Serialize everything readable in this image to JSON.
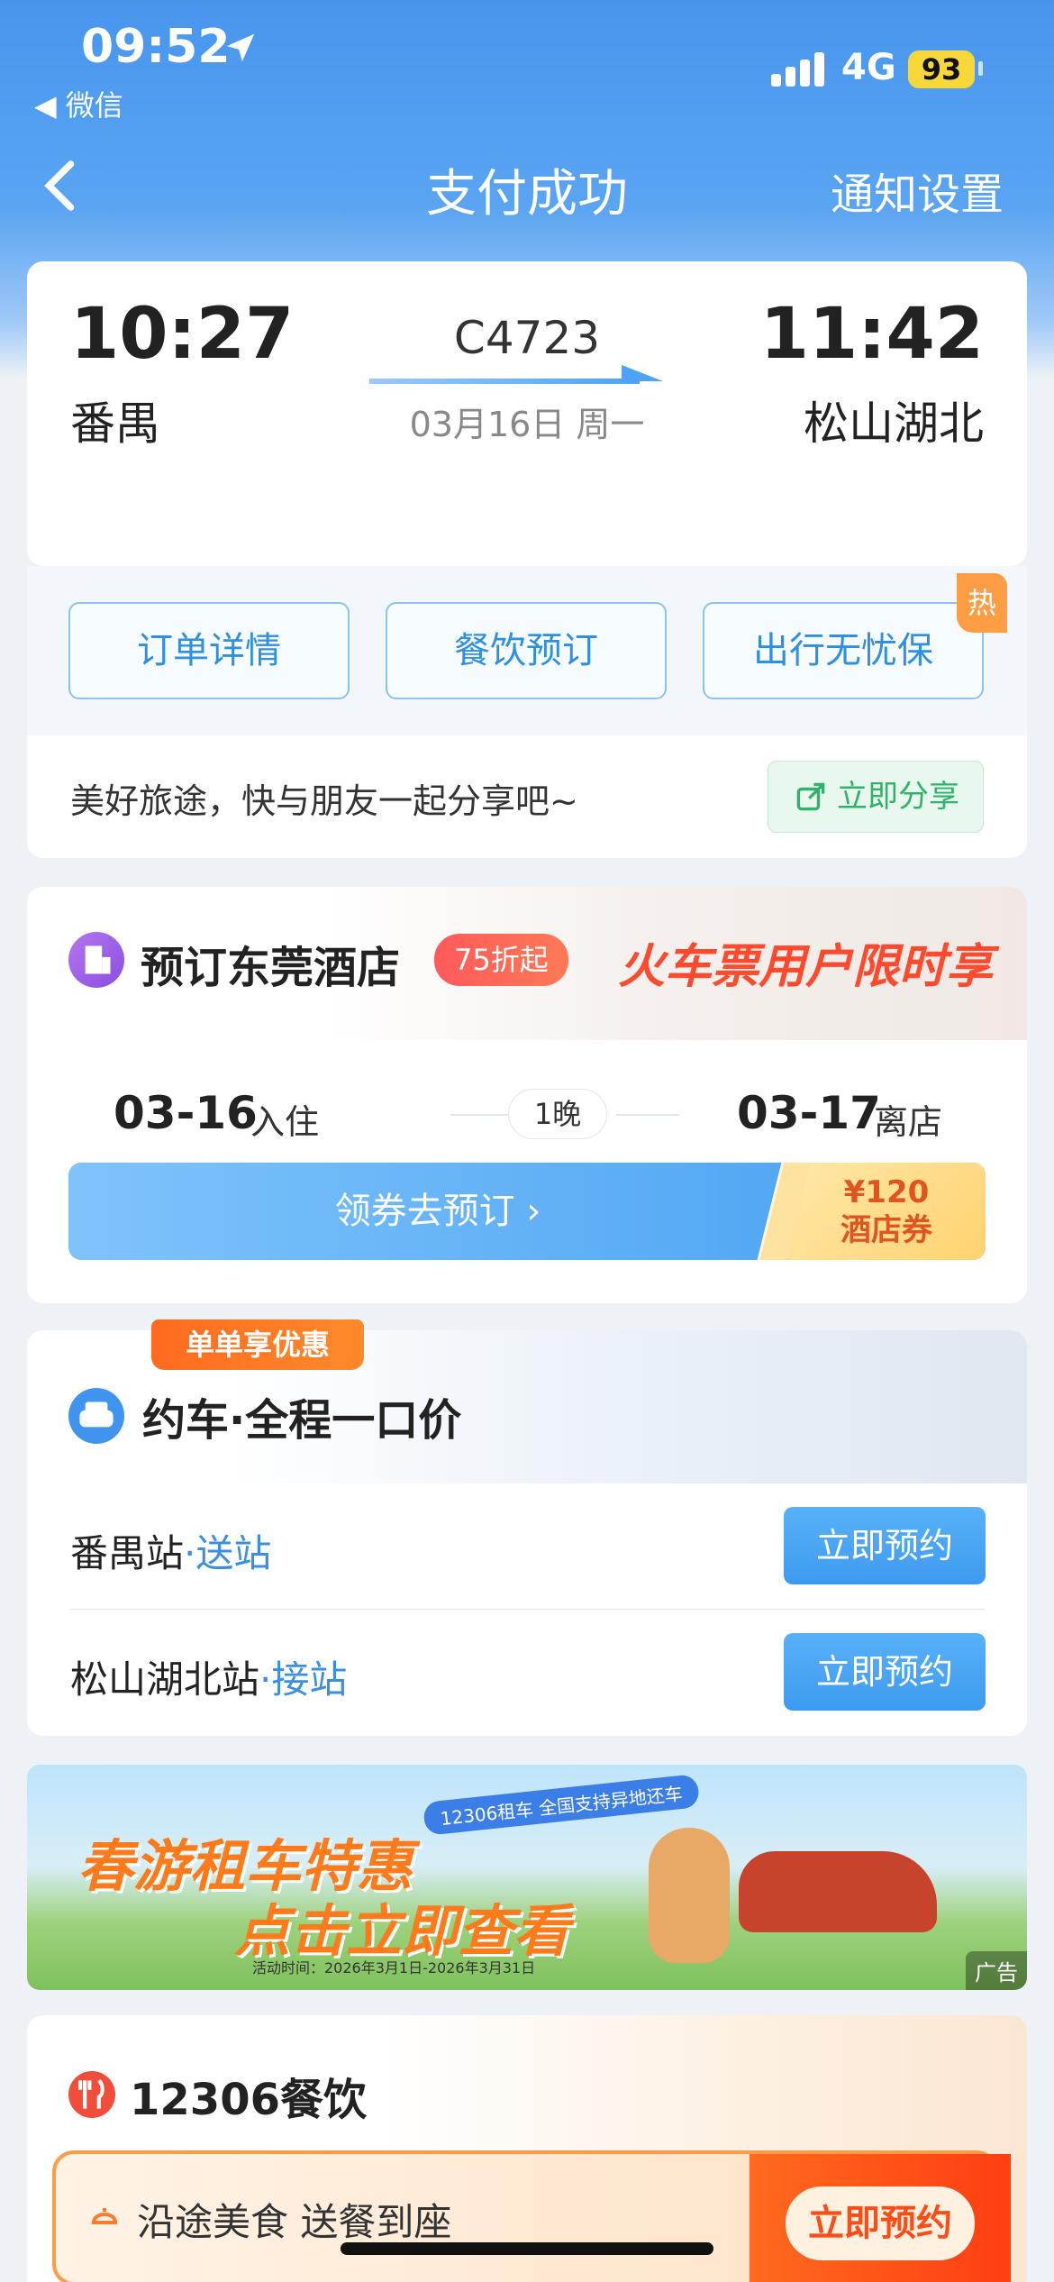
{
  "status_bar": {
    "time": "09:52",
    "back_app": "◀ 微信",
    "network": "4G",
    "battery": "93"
  },
  "nav": {
    "title": "支付成功",
    "right": "通知设置"
  },
  "ticket": {
    "depart_time": "10:27",
    "depart_station": "番禺",
    "train_no": "C4723",
    "date": "03月16日 周一",
    "arrive_time": "11:42",
    "arrive_station": "松山湖北"
  },
  "actions": [
    {
      "label": "订单详情"
    },
    {
      "label": "餐饮预订"
    },
    {
      "label": "出行无忧保",
      "badge": "热"
    }
  ],
  "share": {
    "text": "美好旅途，快与朋友一起分享吧~",
    "button": "立即分享"
  },
  "hotel": {
    "title": "预订东莞酒店",
    "discount": "75折起",
    "promo": "火车票用户限时享",
    "checkin_date": "03-16",
    "checkin_label": "入住",
    "nights": "1晚",
    "checkout_date": "03-17",
    "checkout_label": "离店",
    "coupon_action": "领券去预订 ›",
    "coupon_amount": "¥120",
    "coupon_type": "酒店券"
  },
  "car": {
    "badge": "单单享优惠",
    "title": "约车·全程一口价",
    "rows": [
      {
        "station": "番禺站",
        "type": "·送站",
        "button": "立即预约"
      },
      {
        "station": "松山湖北站",
        "type": "·接站",
        "button": "立即预约"
      }
    ]
  },
  "banner": {
    "tag": "12306租车 全国支持异地还车",
    "line1": "春游租车特惠",
    "line2": "点击立即查看",
    "period": "活动时间：2026年3月1日-2026年3月31日",
    "ad": "广告"
  },
  "food": {
    "title": "12306餐饮",
    "text": "沿途美食  送餐到座",
    "button": "立即预约"
  },
  "colors": {
    "primary": "#3e94ee",
    "orange": "#ff6a1e",
    "green": "#2fb36a"
  }
}
